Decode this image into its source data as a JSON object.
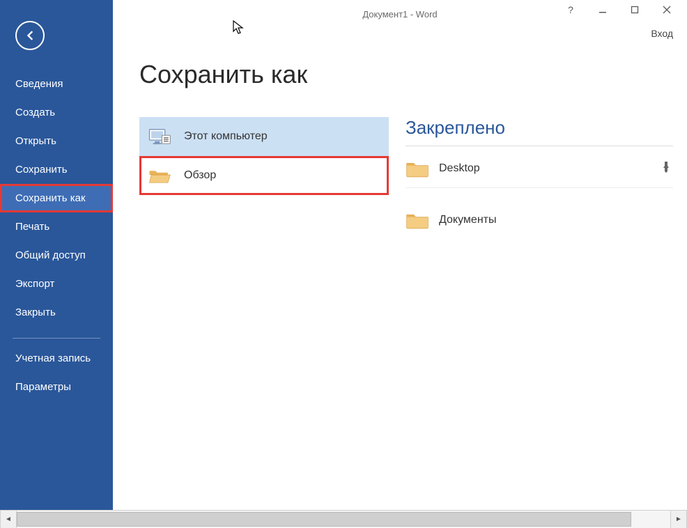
{
  "window": {
    "title": "Документ1 - Word",
    "signin": "Вход"
  },
  "sidebar": {
    "items": [
      {
        "label": "Сведения"
      },
      {
        "label": "Создать"
      },
      {
        "label": "Открыть"
      },
      {
        "label": "Сохранить"
      },
      {
        "label": "Сохранить как"
      },
      {
        "label": "Печать"
      },
      {
        "label": "Общий доступ"
      },
      {
        "label": "Экспорт"
      },
      {
        "label": "Закрыть"
      }
    ],
    "footer": [
      {
        "label": "Учетная запись"
      },
      {
        "label": "Параметры"
      }
    ]
  },
  "page": {
    "title": "Сохранить как",
    "locations": [
      {
        "label": "Этот компьютер"
      },
      {
        "label": "Обзор"
      }
    ],
    "section_header": "Закреплено",
    "folders": [
      {
        "label": "Desktop",
        "pinned": true
      },
      {
        "label": "Документы",
        "pinned": false
      }
    ]
  }
}
